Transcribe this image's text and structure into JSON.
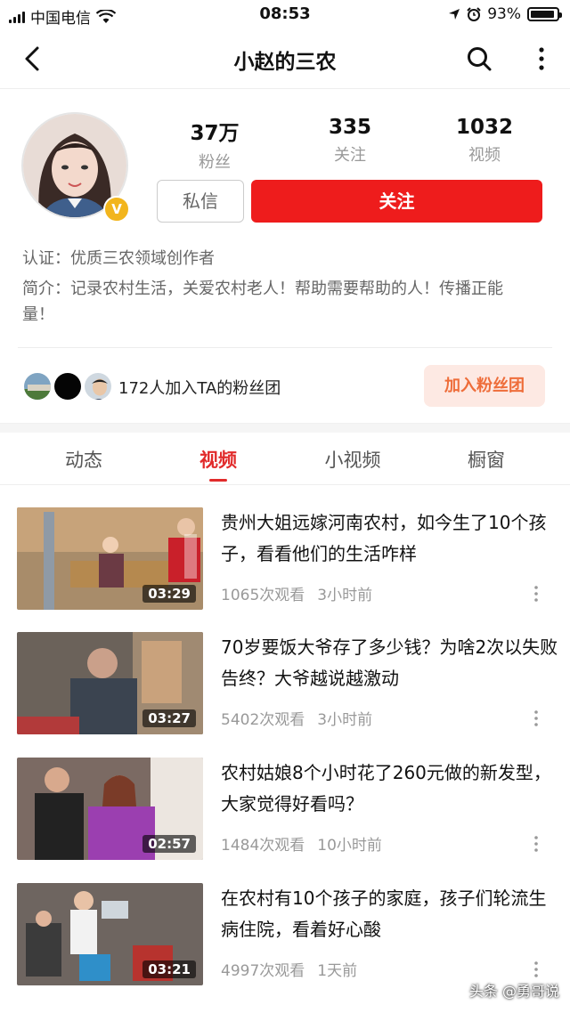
{
  "status_bar": {
    "carrier": "中国电信",
    "time": "08:53",
    "battery": "93%",
    "battery_level": 0.93
  },
  "header": {
    "title": "小赵的三农"
  },
  "profile": {
    "stats": [
      {
        "value": "37万",
        "label": "粉丝"
      },
      {
        "value": "335",
        "label": "关注"
      },
      {
        "value": "1032",
        "label": "视频"
      }
    ],
    "badge": "V",
    "message_label": "私信",
    "follow_label": "关注",
    "certification": "认证：优质三农领域创作者",
    "intro": "简介：记录农村生活，关爱农村老人！帮助需要帮助的人！传播正能量！"
  },
  "fans": {
    "text": "172人加入TA的粉丝团",
    "join_label": "加入粉丝团"
  },
  "tabs": [
    {
      "label": "动态",
      "active": false
    },
    {
      "label": "视频",
      "active": true
    },
    {
      "label": "小视频",
      "active": false
    },
    {
      "label": "橱窗",
      "active": false
    }
  ],
  "videos": [
    {
      "title": "贵州大姐远嫁河南农村，如今生了10个孩子，看看他们的生活咋样",
      "duration": "03:29",
      "views": "1065次观看",
      "time": "3小时前"
    },
    {
      "title": "70岁要饭大爷存了多少钱？为啥2次以失败告终？大爷越说越激动",
      "duration": "03:27",
      "views": "5402次观看",
      "time": "3小时前"
    },
    {
      "title": "农村姑娘8个小时花了260元做的新发型，大家觉得好看吗？",
      "duration": "02:57",
      "views": "1484次观看",
      "time": "10小时前"
    },
    {
      "title": "在农村有10个孩子的家庭，孩子们轮流生病住院，看着好心酸",
      "duration": "03:21",
      "views": "4997次观看",
      "time": "1天前"
    }
  ],
  "watermark": "头条 @勇哥说",
  "colors": {
    "accent": "#ee1c1c",
    "tab_active": "#e12b2b",
    "fanclub_text": "#ee6d3a",
    "fanclub_bg": "#fde9e3",
    "verified_badge": "#f2b51d"
  }
}
